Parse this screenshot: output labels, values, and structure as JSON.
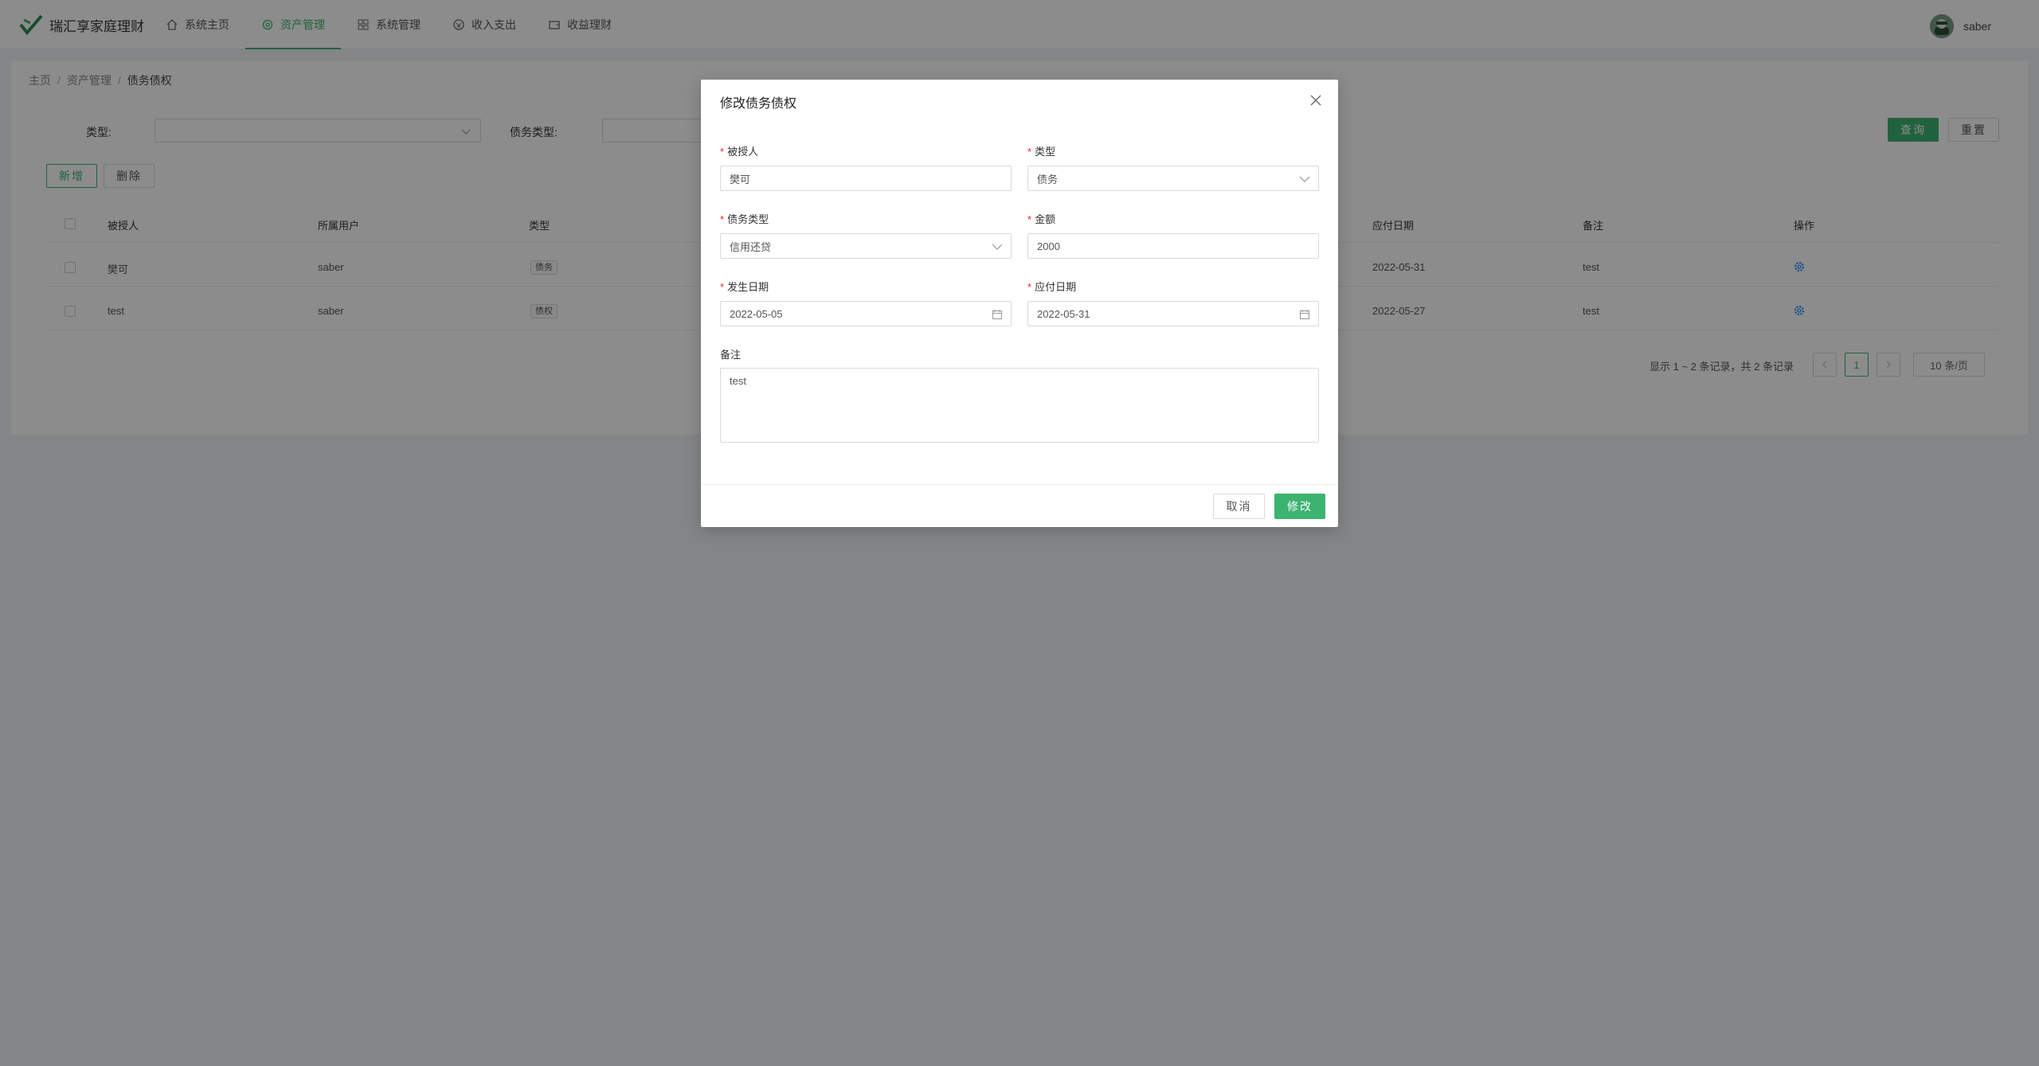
{
  "app": {
    "title": "瑞汇享家庭理财"
  },
  "nav": [
    {
      "label": "系统主页",
      "icon": "home-icon"
    },
    {
      "label": "资产管理",
      "icon": "asset-icon",
      "active": true
    },
    {
      "label": "系统管理",
      "icon": "grid-icon"
    },
    {
      "label": "收入支出",
      "icon": "money-icon"
    },
    {
      "label": "收益理财",
      "icon": "wallet-icon"
    }
  ],
  "user": {
    "name": "saber"
  },
  "breadcrumb": [
    "主页",
    "资产管理",
    "债务债权"
  ],
  "filters": {
    "type_label": "类型:",
    "debt_type_label": "债务类型:",
    "query_label": "查询",
    "reset_label": "重置"
  },
  "toolbar": {
    "add_label": "新增",
    "delete_label": "删除"
  },
  "table": {
    "columns": [
      "被授人",
      "所属用户",
      "类型",
      "应付日期",
      "备注",
      "操作"
    ],
    "rows": [
      {
        "name": "樊可",
        "user": "saber",
        "type": "债务",
        "due_date": "2022-05-31",
        "note": "test"
      },
      {
        "name": "test",
        "user": "saber",
        "type": "债权",
        "due_date": "2022-05-27",
        "note": "test"
      }
    ]
  },
  "pagination": {
    "info": "显示 1 ~ 2 条记录，共 2 条记录",
    "current_page": "1",
    "page_size": "10 条/页"
  },
  "modal": {
    "title": "修改债务债权",
    "fields": {
      "person": {
        "label": "被授人",
        "value": "樊可"
      },
      "type": {
        "label": "类型",
        "value": "债务"
      },
      "debt_type": {
        "label": "债务类型",
        "value": "信用还贷"
      },
      "amount": {
        "label": "金额",
        "value": "2000"
      },
      "occur_date": {
        "label": "发生日期",
        "value": "2022-05-05"
      },
      "due_date": {
        "label": "应付日期",
        "value": "2022-05-31"
      },
      "note": {
        "label": "备注",
        "value": "test"
      }
    },
    "cancel_label": "取消",
    "submit_label": "修改"
  },
  "colors": {
    "accent": "#3cb371",
    "required": "#f5222d",
    "gear": "#1890ff"
  }
}
